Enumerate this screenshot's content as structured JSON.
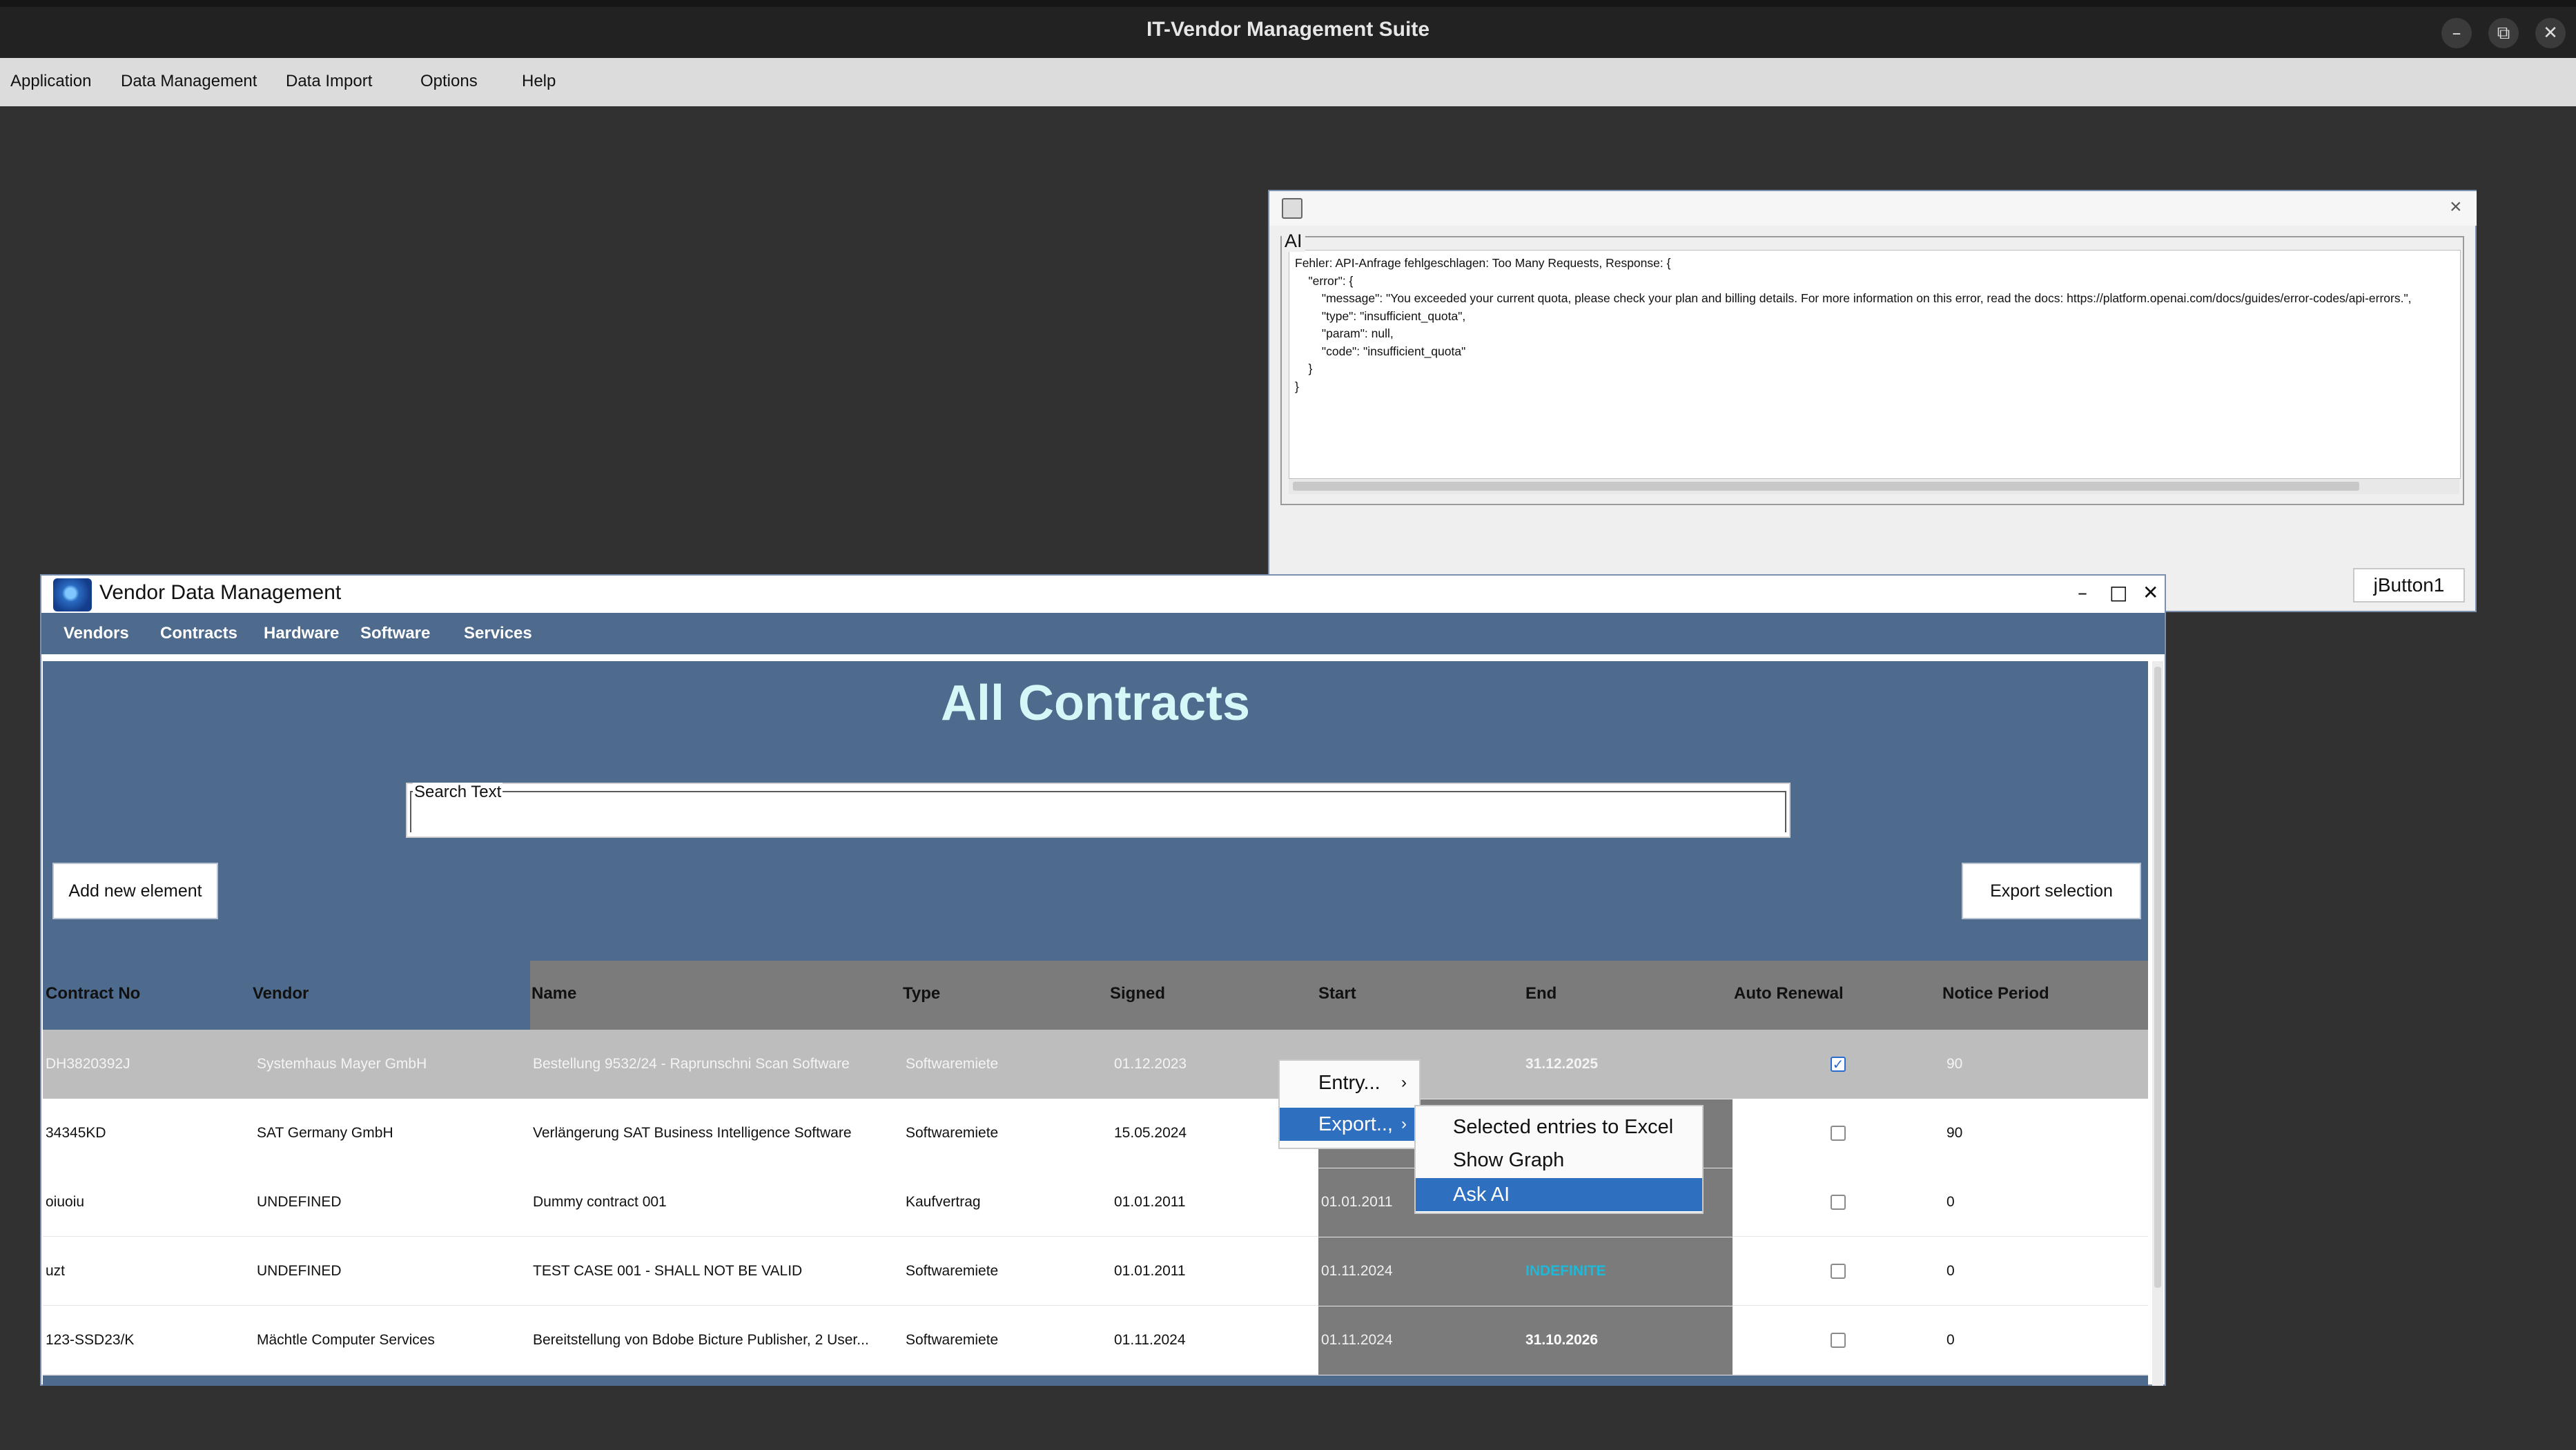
{
  "app": {
    "title": "IT-Vendor Management Suite",
    "menu": [
      "Application",
      "Data Management",
      "Data Import",
      "Options",
      "Help"
    ]
  },
  "ai_dialog": {
    "group_label": "AI",
    "response_text": "Fehler: API-Anfrage fehlgeschlagen: Too Many Requests, Response: {\n    \"error\": {\n        \"message\": \"You exceeded your current quota, please check your plan and billing details. For more information on this error, read the docs: https://platform.openai.com/docs/guides/error-codes/api-errors.\",\n        \"type\": \"insufficient_quota\",\n        \"param\": null,\n        \"code\": \"insufficient_quota\"\n    }\n}",
    "button_label": "jButton1",
    "close_symbol": "×"
  },
  "vendor_window": {
    "title": "Vendor Data Management",
    "controls": {
      "minimize": "–",
      "maximize": "□",
      "close": "✕"
    },
    "menu": [
      "Vendors",
      "Contracts",
      "Hardware",
      "Software",
      "Services"
    ],
    "page_title": "All Contracts",
    "search": {
      "label": "Search Text",
      "value": ""
    },
    "add_button": "Add new element",
    "export_button": "Export selection",
    "columns": [
      "Contract No",
      "Vendor",
      "Name",
      "Type",
      "Signed",
      "Start",
      "End",
      "Auto Renewal",
      "Notice Period"
    ],
    "rows": [
      {
        "contract_no": "DH3820392J",
        "vendor": "Systemhaus Mayer GmbH",
        "name": "Bestellung 9532/24 - Raprunschni Scan Software",
        "type": "Softwaremiete",
        "signed": "01.12.2023",
        "start": "",
        "end": "31.12.2025",
        "auto_renewal": true,
        "notice_period": "90",
        "selected": true
      },
      {
        "contract_no": "34345KD",
        "vendor": "SAT Germany GmbH",
        "name": "Verlängerung SAT Business Intelligence Software",
        "type": "Softwaremiete",
        "signed": "15.05.2024",
        "start": "",
        "end": "",
        "auto_renewal": false,
        "notice_period": "90"
      },
      {
        "contract_no": "oiuoiu",
        "vendor": "UNDEFINED",
        "name": "Dummy contract 001",
        "type": "Kaufvertrag",
        "signed": "01.01.2011",
        "start": "01.01.2011",
        "end": "",
        "auto_renewal": false,
        "notice_period": "0"
      },
      {
        "contract_no": "uzt",
        "vendor": "UNDEFINED",
        "name": "TEST CASE 001 - SHALL NOT BE VALID",
        "type": "Softwaremiete",
        "signed": "01.01.2011",
        "start": "01.11.2024",
        "end": "INDEFINITE",
        "auto_renewal": false,
        "notice_period": "0"
      },
      {
        "contract_no": "123-SSD23/K",
        "vendor": "Mächtle Computer Services",
        "name": "Bereitstellung von Bdobe Bicture Publisher, 2 User...",
        "type": "Softwaremiete",
        "signed": "01.11.2024",
        "start": "01.11.2024",
        "end": "31.10.2026",
        "auto_renewal": false,
        "notice_period": "0"
      }
    ]
  },
  "context_menu": {
    "items": [
      {
        "label": "Entry...",
        "submenu": true
      },
      {
        "label": "Export..,",
        "submenu": true,
        "highlighted": true
      }
    ]
  },
  "export_submenu": {
    "items": [
      {
        "label": "Selected entries to Excel"
      },
      {
        "label": "Show Graph"
      },
      {
        "label": "Ask AI",
        "highlighted": true
      }
    ]
  },
  "colors": {
    "accent": "#4e6a8c",
    "highlight": "#2f6fbf",
    "indefinite": "#1fb8d8"
  }
}
